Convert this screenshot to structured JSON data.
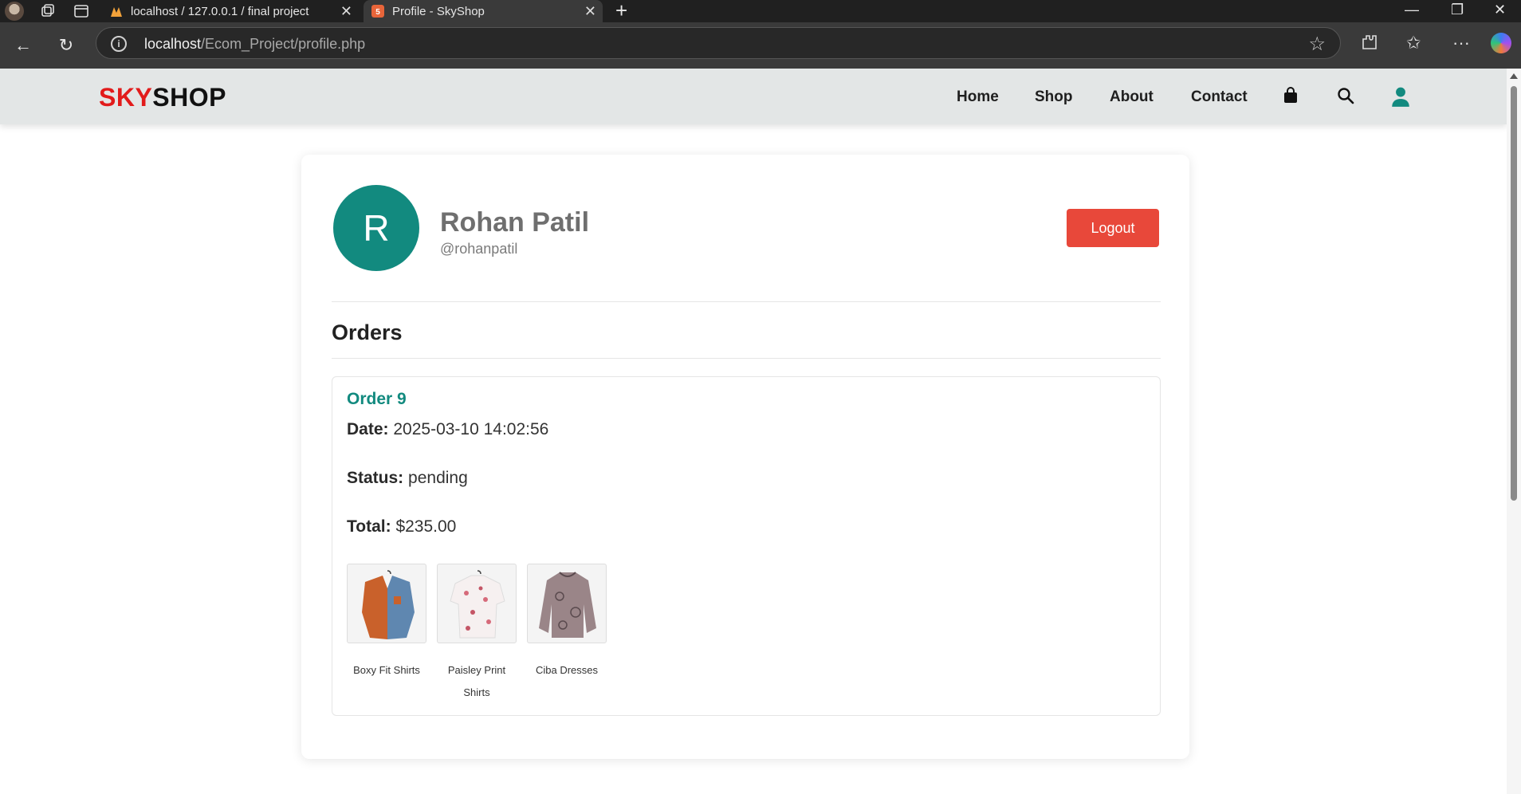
{
  "browser": {
    "tabs": [
      {
        "title": "localhost / 127.0.0.1 / final project",
        "favicon": "phpmyadmin-icon",
        "active": false
      },
      {
        "title": "Profile - SkyShop",
        "favicon": "html5-icon",
        "active": true
      }
    ],
    "url_host": "localhost",
    "url_path": "/Ecom_Project/profile.php"
  },
  "site": {
    "logo_part1": "SKY",
    "logo_part2": "SHOP",
    "nav": [
      "Home",
      "Shop",
      "About",
      "Contact"
    ],
    "icons": [
      "shopping-bag-icon",
      "search-icon",
      "user-icon"
    ],
    "accent": "#128a7f",
    "logo_red": "#e21b1b"
  },
  "profile": {
    "initial": "R",
    "name": "Rohan Patil",
    "handle": "@rohanpatil",
    "logout_label": "Logout",
    "logout_color": "#e8483a"
  },
  "orders": {
    "heading": "Orders",
    "items": [
      {
        "title": "Order 9",
        "date_label": "Date:",
        "date": "2025-03-10 14:02:56",
        "status_label": "Status:",
        "status": "pending",
        "total_label": "Total:",
        "total": "$235.00",
        "products": [
          "Boxy Fit Shirts",
          "Paisley Print Shirts",
          "Ciba Dresses"
        ]
      }
    ]
  }
}
